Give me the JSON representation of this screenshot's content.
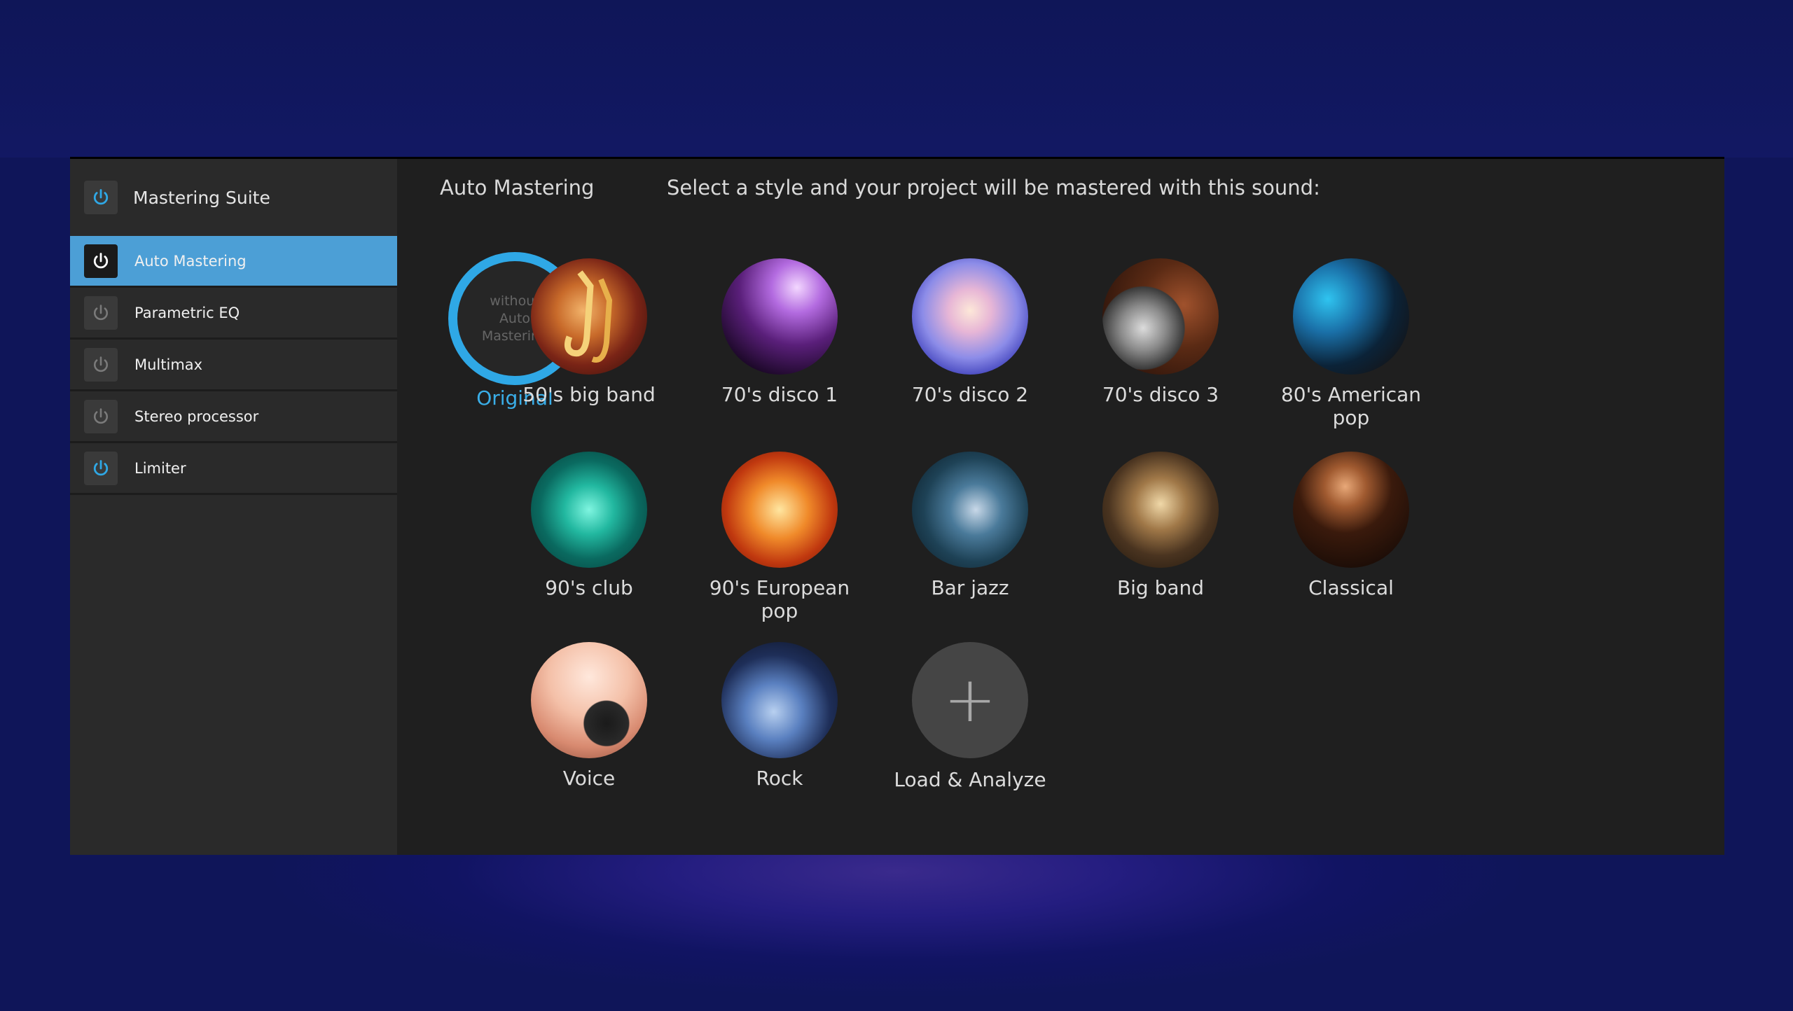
{
  "sidebar": {
    "title": "Mastering Suite",
    "items": [
      {
        "label": "Auto Mastering",
        "active": true,
        "power_on": true
      },
      {
        "label": "Parametric EQ",
        "active": false,
        "power_on": false
      },
      {
        "label": "Multimax",
        "active": false,
        "power_on": false
      },
      {
        "label": "Stereo processor",
        "active": false,
        "power_on": false
      },
      {
        "label": "Limiter",
        "active": false,
        "power_on": true
      }
    ]
  },
  "main": {
    "heading": "Auto Mastering",
    "instruction": "Select a style and your project will be mastered with this sound:",
    "original": {
      "inner_text_1": "without",
      "inner_text_2": "Auto",
      "inner_text_3": "Mastering",
      "label": "Original"
    },
    "styles": [
      {
        "label": "50's big band",
        "icon": "saxophone-image"
      },
      {
        "label": "70's disco 1",
        "icon": "disco-ball-image"
      },
      {
        "label": "70's disco 2",
        "icon": "singer-image"
      },
      {
        "label": "70's disco 3",
        "icon": "disco-dancer-image"
      },
      {
        "label": "80's American pop",
        "icon": "guitarist-image"
      },
      {
        "label": "90's club",
        "icon": "dj-image"
      },
      {
        "label": "90's European pop",
        "icon": "dancer-fire-image"
      },
      {
        "label": "Bar jazz",
        "icon": "trumpet-player-image"
      },
      {
        "label": "Big band",
        "icon": "brass-section-image"
      },
      {
        "label": "Classical",
        "icon": "violin-image"
      },
      {
        "label": "Voice",
        "icon": "microphone-singer-image"
      },
      {
        "label": "Rock",
        "icon": "electric-guitar-image"
      }
    ],
    "load": {
      "label": "Load & Analyze",
      "icon": "plus-icon"
    }
  },
  "colors": {
    "accent": "#4c9fd6",
    "selection_ring": "#2fa8e6",
    "background": "#1f1f1f"
  }
}
